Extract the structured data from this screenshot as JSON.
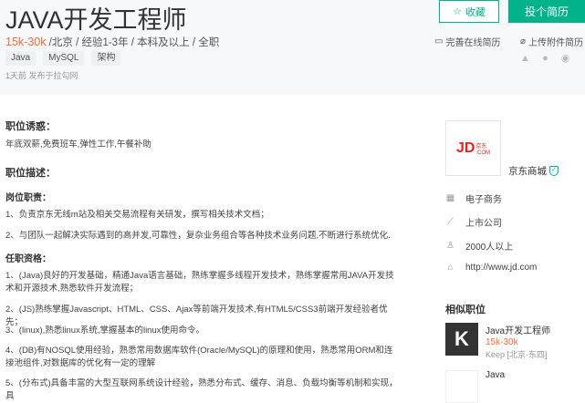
{
  "job": {
    "title": "JAVA开发工程师",
    "salary": "15k-30k",
    "meta": " /北京 / 经验1-3年 / 本科及以上 / 全职",
    "tags": [
      "Java",
      "MySQL",
      "架构"
    ],
    "publish": "1天前  发布于拉勾网"
  },
  "actions": {
    "collect": "收藏",
    "apply": "投个简历",
    "online_resume": "完善在线简历",
    "upload_resume": "上传附件简历"
  },
  "content": {
    "temptation_title": "职位诱惑：",
    "temptation": "年底双薪,免费班车,弹性工作,午餐补助",
    "desc_title": "职位描述：",
    "duty_title": "岗位职责：",
    "duties": [
      "1、负责京东无线m站及相关交易流程有关研发，撰写相关技术文档；",
      "2、与团队一起解决实际遇到的高并发,可靠性，复杂业务组合等各种技术业务问题,不断进行系统优化."
    ],
    "req_title": "任职资格：",
    "requirements": [
      "1、(Java)良好的开发基础，精通Java语言基础，熟练掌握多线程开发技术，熟练掌握常用JAVA开发技术和开源技术,熟悉软件开发流程；",
      "2、(JS)熟练掌握Javascript、HTML、CSS、Ajax等前端开发技术,有HTML5/CSS3前端开发经验者优先；",
      "3、(linux),熟悉linux系统,掌握基本的linux使用命令。",
      "4、(DB)有NOSQL使用经验，熟悉常用数据库软件(Oracle/MySQL)的原理和使用，熟悉常用ORM和连接池组件,对数据库的优化有一定的理解",
      "5、(分布式)具备丰富的大型互联网系统设计经验，熟悉分布式、缓存、消息、负载均衡等机制和实现，具"
    ]
  },
  "company": {
    "logo_text": "JD",
    "logo_sub": "京东",
    "logo_sub2": ".COM",
    "name": "京东商城",
    "field": "电子商务",
    "stage": "上市公司",
    "size": "2000人以上",
    "site": "http://www.jd.com"
  },
  "similar": {
    "title": "相似职位",
    "items": [
      {
        "logo": "K",
        "name": "Java开发工程师",
        "salary": "15k-30k",
        "company": "Keep [北京·东四]"
      },
      {
        "logo": "",
        "name": "Java",
        "salary": "",
        "company": ""
      }
    ]
  }
}
